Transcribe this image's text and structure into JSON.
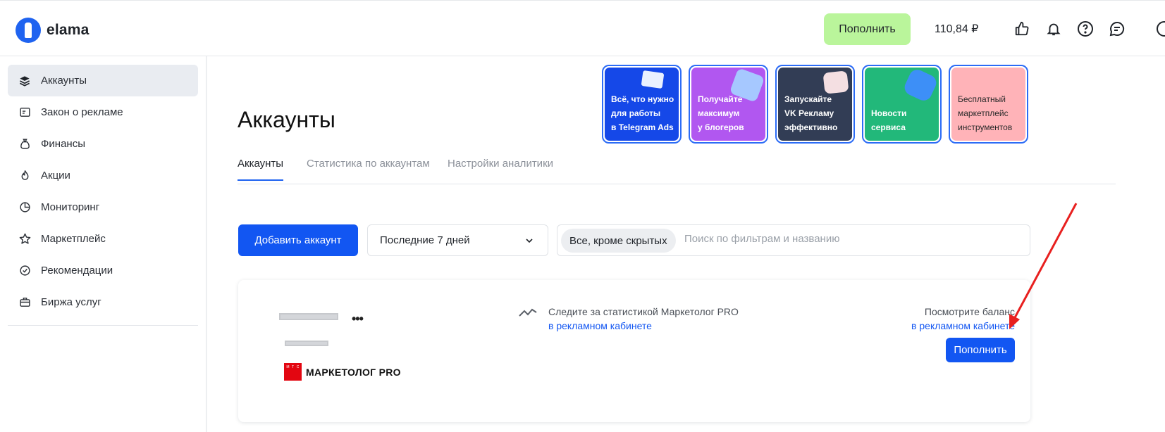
{
  "header": {
    "logo_text": "elama",
    "topup_label": "Пополнить",
    "balance": "110,84 ₽",
    "icons": [
      "thumbs-up-icon",
      "bell-icon",
      "help-icon",
      "chat-icon",
      "profile-icon"
    ]
  },
  "sidebar": {
    "items": [
      {
        "label": "Аккаунты",
        "icon": "layers-icon",
        "active": true
      },
      {
        "label": "Закон о рекламе",
        "icon": "card-icon"
      },
      {
        "label": "Финансы",
        "icon": "money-bag-icon"
      },
      {
        "label": "Акции",
        "icon": "fire-icon"
      },
      {
        "label": "Мониторинг",
        "icon": "pie-chart-icon"
      },
      {
        "label": "Маркетплейс",
        "icon": "star-icon"
      },
      {
        "label": "Рекомендации",
        "icon": "check-badge-icon"
      },
      {
        "label": "Биржа услуг",
        "icon": "briefcase-icon"
      }
    ]
  },
  "page": {
    "title": "Аккаунты",
    "promos": [
      {
        "lines": [
          "Всё, что нужно",
          "для работы",
          "в Telegram Ads"
        ],
        "color": "#1548e8"
      },
      {
        "lines": [
          "Получайте",
          "максимум",
          "у блогеров"
        ],
        "color": "#b157f0"
      },
      {
        "lines": [
          "Запускайте",
          "VK Рекламу",
          "эффективно"
        ],
        "color": "#323d55"
      },
      {
        "lines": [
          "Новости",
          "сервиса"
        ],
        "color": "#22b87a"
      },
      {
        "lines": [
          "Бесплатный",
          "маркетплейс",
          "инструментов"
        ],
        "color": "#ffb3b8"
      }
    ],
    "tabs": [
      {
        "label": "Аккаунты",
        "active": true
      },
      {
        "label": "Статистика по аккаунтам"
      },
      {
        "label": "Настройки аналитики"
      }
    ],
    "add_account_label": "Добавить аккаунт",
    "period_value": "Последние 7 дней",
    "filter_chip": "Все, кроме скрытых",
    "search_placeholder": "Поиск по фильтрам и названию"
  },
  "account_card": {
    "platform_logo_text": "МАРКЕТОЛОГ PRO",
    "mts_letters": "М Т С",
    "stats_text": "Следите за статистикой Маркетолог PRO",
    "stats_link": "в рекламном кабинете",
    "balance_text": "Посмотрите баланс",
    "balance_link": "в рекламном кабинете",
    "topup_label": "Пополнить"
  },
  "colors": {
    "accent": "#1256f2",
    "topup_green": "#baf59b",
    "annotation_arrow": "#e8201f"
  }
}
